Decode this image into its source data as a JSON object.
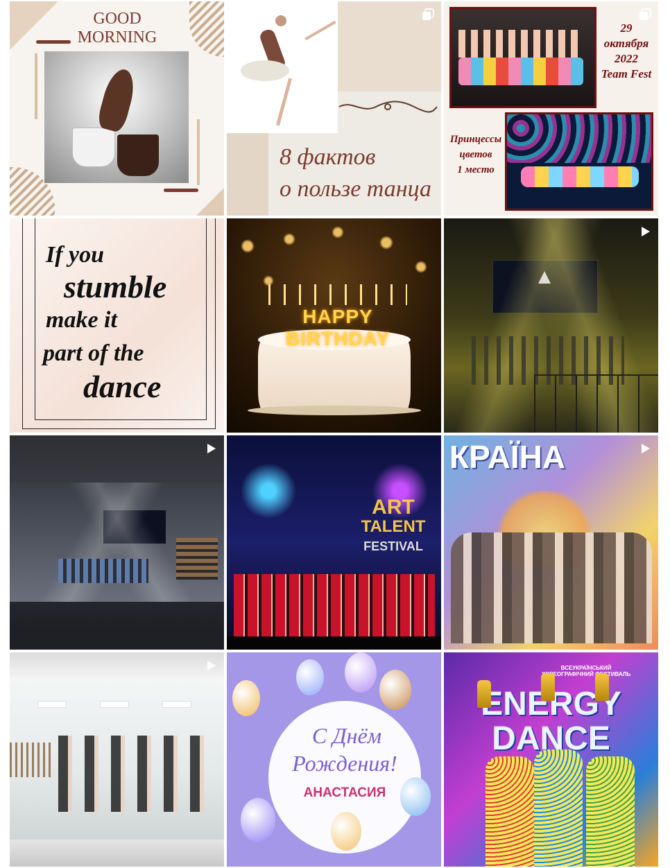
{
  "posts": [
    {
      "type": "image",
      "overlay_text": [
        "GOOD MORNING"
      ]
    },
    {
      "type": "carousel",
      "overlay_text": [
        "8 фактов",
        "о пользе танца"
      ]
    },
    {
      "type": "carousel",
      "overlay_text": [
        "29",
        "октября",
        "2022",
        "Team Fest",
        "Принцессы",
        "цветов",
        "1 место"
      ]
    },
    {
      "type": "image",
      "overlay_text": [
        "If you",
        "stumble",
        "make it",
        "part of the",
        "dance"
      ]
    },
    {
      "type": "image",
      "overlay_text": [
        "HAPPY BIRTHDAY"
      ]
    },
    {
      "type": "reel",
      "overlay_text": []
    },
    {
      "type": "reel",
      "overlay_text": []
    },
    {
      "type": "image",
      "overlay_text": [
        "ART",
        "TALENT",
        "FESTIVAL"
      ]
    },
    {
      "type": "reel",
      "overlay_text": [
        "КРАЇНА"
      ]
    },
    {
      "type": "reel",
      "overlay_text": []
    },
    {
      "type": "image",
      "overlay_text": [
        "С Днём",
        "Рождения!",
        "АНАСТАСИЯ"
      ]
    },
    {
      "type": "image",
      "overlay_text": [
        "ВСЕУКРАЇНСЬКИЙ",
        "ХОРЕОГРАФІЧНИЙ ФЕСТИВАЛЬ",
        "ENERGY",
        "DANCE"
      ]
    }
  ],
  "icons": {
    "carousel": "carousel-icon",
    "reel": "reel-icon"
  },
  "colors": {
    "accent_brown": "#7a3b2e",
    "beige": "#e9dccd",
    "maroon": "#6e1010",
    "lilac": "#a497e8"
  }
}
